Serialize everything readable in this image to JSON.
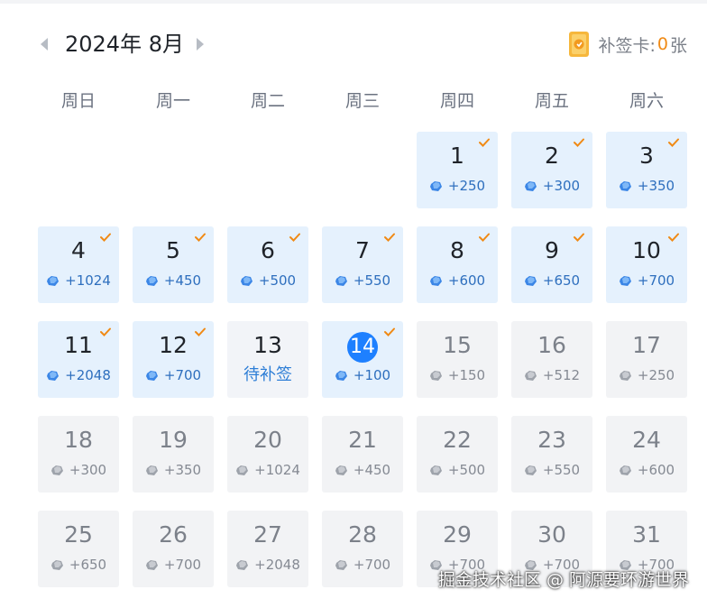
{
  "header": {
    "title": "2024年 8月",
    "makeup_label": "补签卡:",
    "makeup_count": "0",
    "makeup_unit": "张",
    "icons": {
      "prev": "chevron-left-icon",
      "next": "chevron-right-icon",
      "card": "makeup-card-icon"
    }
  },
  "weekdays": [
    "周日",
    "周一",
    "周二",
    "周三",
    "周四",
    "周五",
    "周六"
  ],
  "colors": {
    "accent": "#1e80ff",
    "signed_bg": "#e5f1fd",
    "future_bg": "#f2f3f5",
    "check": "#f08a15"
  },
  "days": [
    {
      "day": "1",
      "reward": "+250",
      "state": "signed"
    },
    {
      "day": "2",
      "reward": "+300",
      "state": "signed"
    },
    {
      "day": "3",
      "reward": "+350",
      "state": "signed"
    },
    {
      "day": "4",
      "reward": "+1024",
      "state": "signed"
    },
    {
      "day": "5",
      "reward": "+450",
      "state": "signed"
    },
    {
      "day": "6",
      "reward": "+500",
      "state": "signed"
    },
    {
      "day": "7",
      "reward": "+550",
      "state": "signed"
    },
    {
      "day": "8",
      "reward": "+600",
      "state": "signed"
    },
    {
      "day": "9",
      "reward": "+650",
      "state": "signed"
    },
    {
      "day": "10",
      "reward": "+700",
      "state": "signed"
    },
    {
      "day": "11",
      "reward": "+2048",
      "state": "signed"
    },
    {
      "day": "12",
      "reward": "+700",
      "state": "signed"
    },
    {
      "day": "13",
      "label": "待补签",
      "state": "missed"
    },
    {
      "day": "14",
      "reward": "+100",
      "state": "today"
    },
    {
      "day": "15",
      "reward": "+150",
      "state": "future"
    },
    {
      "day": "16",
      "reward": "+512",
      "state": "future"
    },
    {
      "day": "17",
      "reward": "+250",
      "state": "future"
    },
    {
      "day": "18",
      "reward": "+300",
      "state": "future"
    },
    {
      "day": "19",
      "reward": "+350",
      "state": "future"
    },
    {
      "day": "20",
      "reward": "+1024",
      "state": "future"
    },
    {
      "day": "21",
      "reward": "+450",
      "state": "future"
    },
    {
      "day": "22",
      "reward": "+500",
      "state": "future"
    },
    {
      "day": "23",
      "reward": "+550",
      "state": "future"
    },
    {
      "day": "24",
      "reward": "+600",
      "state": "future"
    },
    {
      "day": "25",
      "reward": "+650",
      "state": "future"
    },
    {
      "day": "26",
      "reward": "+700",
      "state": "future"
    },
    {
      "day": "27",
      "reward": "+2048",
      "state": "future"
    },
    {
      "day": "28",
      "reward": "+700",
      "state": "future"
    },
    {
      "day": "29",
      "reward": "+700",
      "state": "future"
    },
    {
      "day": "30",
      "reward": "+700",
      "state": "future"
    },
    {
      "day": "31",
      "reward": "+700",
      "state": "future"
    }
  ],
  "first_weekday": 4,
  "watermark": "掘金技术社区 @ 阿源要环游世界"
}
